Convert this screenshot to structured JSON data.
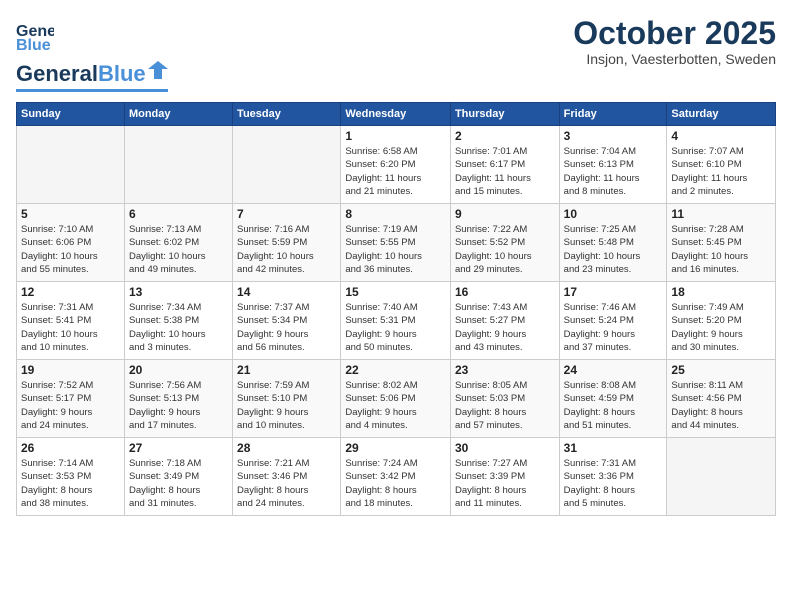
{
  "header": {
    "logo_line1": "General",
    "logo_line2": "Blue",
    "month": "October 2025",
    "location": "Insjon, Vaesterbotten, Sweden"
  },
  "days_of_week": [
    "Sunday",
    "Monday",
    "Tuesday",
    "Wednesday",
    "Thursday",
    "Friday",
    "Saturday"
  ],
  "weeks": [
    [
      {
        "day": "",
        "info": ""
      },
      {
        "day": "",
        "info": ""
      },
      {
        "day": "",
        "info": ""
      },
      {
        "day": "1",
        "info": "Sunrise: 6:58 AM\nSunset: 6:20 PM\nDaylight: 11 hours\nand 21 minutes."
      },
      {
        "day": "2",
        "info": "Sunrise: 7:01 AM\nSunset: 6:17 PM\nDaylight: 11 hours\nand 15 minutes."
      },
      {
        "day": "3",
        "info": "Sunrise: 7:04 AM\nSunset: 6:13 PM\nDaylight: 11 hours\nand 8 minutes."
      },
      {
        "day": "4",
        "info": "Sunrise: 7:07 AM\nSunset: 6:10 PM\nDaylight: 11 hours\nand 2 minutes."
      }
    ],
    [
      {
        "day": "5",
        "info": "Sunrise: 7:10 AM\nSunset: 6:06 PM\nDaylight: 10 hours\nand 55 minutes."
      },
      {
        "day": "6",
        "info": "Sunrise: 7:13 AM\nSunset: 6:02 PM\nDaylight: 10 hours\nand 49 minutes."
      },
      {
        "day": "7",
        "info": "Sunrise: 7:16 AM\nSunset: 5:59 PM\nDaylight: 10 hours\nand 42 minutes."
      },
      {
        "day": "8",
        "info": "Sunrise: 7:19 AM\nSunset: 5:55 PM\nDaylight: 10 hours\nand 36 minutes."
      },
      {
        "day": "9",
        "info": "Sunrise: 7:22 AM\nSunset: 5:52 PM\nDaylight: 10 hours\nand 29 minutes."
      },
      {
        "day": "10",
        "info": "Sunrise: 7:25 AM\nSunset: 5:48 PM\nDaylight: 10 hours\nand 23 minutes."
      },
      {
        "day": "11",
        "info": "Sunrise: 7:28 AM\nSunset: 5:45 PM\nDaylight: 10 hours\nand 16 minutes."
      }
    ],
    [
      {
        "day": "12",
        "info": "Sunrise: 7:31 AM\nSunset: 5:41 PM\nDaylight: 10 hours\nand 10 minutes."
      },
      {
        "day": "13",
        "info": "Sunrise: 7:34 AM\nSunset: 5:38 PM\nDaylight: 10 hours\nand 3 minutes."
      },
      {
        "day": "14",
        "info": "Sunrise: 7:37 AM\nSunset: 5:34 PM\nDaylight: 9 hours\nand 56 minutes."
      },
      {
        "day": "15",
        "info": "Sunrise: 7:40 AM\nSunset: 5:31 PM\nDaylight: 9 hours\nand 50 minutes."
      },
      {
        "day": "16",
        "info": "Sunrise: 7:43 AM\nSunset: 5:27 PM\nDaylight: 9 hours\nand 43 minutes."
      },
      {
        "day": "17",
        "info": "Sunrise: 7:46 AM\nSunset: 5:24 PM\nDaylight: 9 hours\nand 37 minutes."
      },
      {
        "day": "18",
        "info": "Sunrise: 7:49 AM\nSunset: 5:20 PM\nDaylight: 9 hours\nand 30 minutes."
      }
    ],
    [
      {
        "day": "19",
        "info": "Sunrise: 7:52 AM\nSunset: 5:17 PM\nDaylight: 9 hours\nand 24 minutes."
      },
      {
        "day": "20",
        "info": "Sunrise: 7:56 AM\nSunset: 5:13 PM\nDaylight: 9 hours\nand 17 minutes."
      },
      {
        "day": "21",
        "info": "Sunrise: 7:59 AM\nSunset: 5:10 PM\nDaylight: 9 hours\nand 10 minutes."
      },
      {
        "day": "22",
        "info": "Sunrise: 8:02 AM\nSunset: 5:06 PM\nDaylight: 9 hours\nand 4 minutes."
      },
      {
        "day": "23",
        "info": "Sunrise: 8:05 AM\nSunset: 5:03 PM\nDaylight: 8 hours\nand 57 minutes."
      },
      {
        "day": "24",
        "info": "Sunrise: 8:08 AM\nSunset: 4:59 PM\nDaylight: 8 hours\nand 51 minutes."
      },
      {
        "day": "25",
        "info": "Sunrise: 8:11 AM\nSunset: 4:56 PM\nDaylight: 8 hours\nand 44 minutes."
      }
    ],
    [
      {
        "day": "26",
        "info": "Sunrise: 7:14 AM\nSunset: 3:53 PM\nDaylight: 8 hours\nand 38 minutes."
      },
      {
        "day": "27",
        "info": "Sunrise: 7:18 AM\nSunset: 3:49 PM\nDaylight: 8 hours\nand 31 minutes."
      },
      {
        "day": "28",
        "info": "Sunrise: 7:21 AM\nSunset: 3:46 PM\nDaylight: 8 hours\nand 24 minutes."
      },
      {
        "day": "29",
        "info": "Sunrise: 7:24 AM\nSunset: 3:42 PM\nDaylight: 8 hours\nand 18 minutes."
      },
      {
        "day": "30",
        "info": "Sunrise: 7:27 AM\nSunset: 3:39 PM\nDaylight: 8 hours\nand 11 minutes."
      },
      {
        "day": "31",
        "info": "Sunrise: 7:31 AM\nSunset: 3:36 PM\nDaylight: 8 hours\nand 5 minutes."
      },
      {
        "day": "",
        "info": ""
      }
    ]
  ]
}
